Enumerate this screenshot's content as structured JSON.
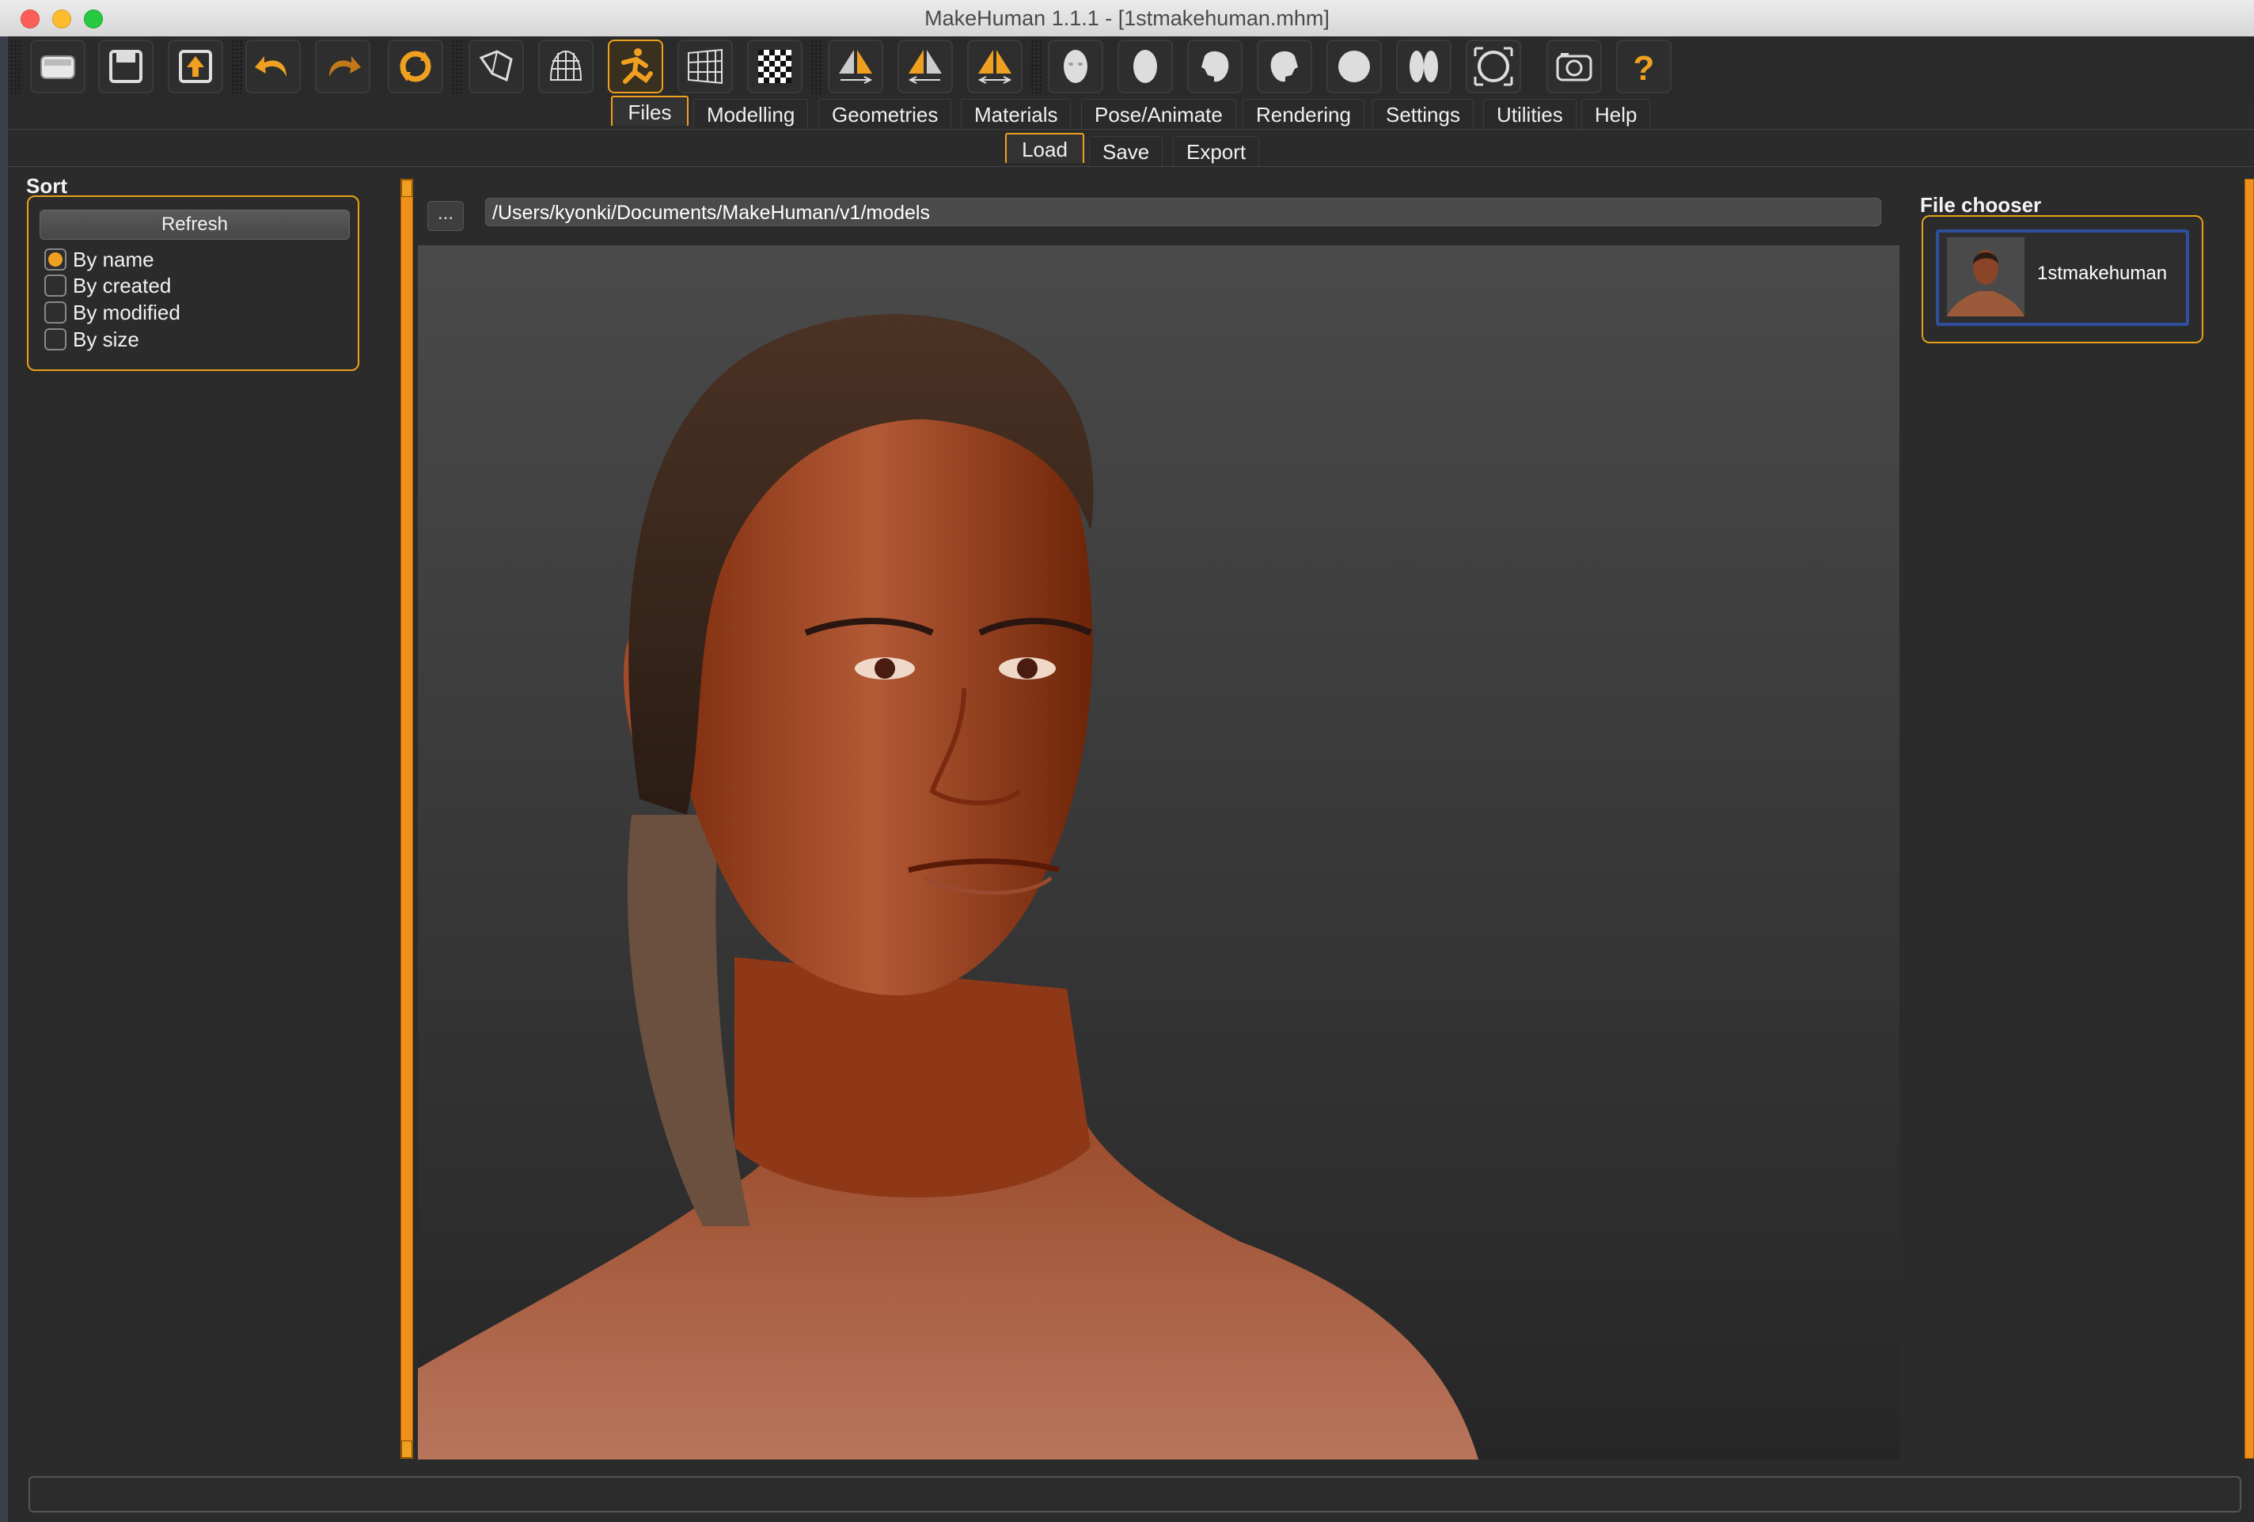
{
  "window": {
    "title": "MakeHuman 1.1.1 - [1stmakehuman.mhm]"
  },
  "toolbar": {
    "buttons": [
      {
        "icon": "open-icon"
      },
      {
        "icon": "save-icon"
      },
      {
        "icon": "export-icon"
      },
      {
        "icon": "undo-icon"
      },
      {
        "icon": "redo-icon"
      },
      {
        "icon": "reset-icon"
      },
      {
        "icon": "smooth-icon"
      },
      {
        "icon": "wireframe-icon"
      },
      {
        "icon": "pose-icon",
        "active": true
      },
      {
        "icon": "grid-icon"
      },
      {
        "icon": "checker-icon"
      },
      {
        "icon": "symmetry-right-icon"
      },
      {
        "icon": "symmetry-left-icon"
      },
      {
        "icon": "symmetry-both-icon"
      },
      {
        "icon": "front-view-icon"
      },
      {
        "icon": "back-view-icon"
      },
      {
        "icon": "left-view-icon"
      },
      {
        "icon": "right-view-icon"
      },
      {
        "icon": "top-view-icon"
      },
      {
        "icon": "bottom-view-icon"
      },
      {
        "icon": "reset-camera-icon"
      },
      {
        "icon": "screenshot-icon"
      },
      {
        "icon": "help-icon"
      }
    ]
  },
  "tabs": {
    "main": [
      "Files",
      "Modelling",
      "Geometries",
      "Materials",
      "Pose/Animate",
      "Rendering",
      "Settings",
      "Utilities",
      "Help"
    ],
    "active_main": "Files",
    "sub": [
      "Load",
      "Save",
      "Export"
    ],
    "active_sub": "Load"
  },
  "sort": {
    "title": "Sort",
    "refresh_label": "Refresh",
    "options": [
      "By name",
      "By created",
      "By modified",
      "By size"
    ],
    "selected": "By name"
  },
  "path": {
    "browse_label": "...",
    "value": "/Users/kyonki/Documents/MakeHuman/v1/models"
  },
  "file_chooser": {
    "title": "File chooser",
    "items": [
      {
        "name": "1stmakehuman",
        "selected": true
      }
    ]
  },
  "colors": {
    "accent": "#f0a020",
    "selection": "#2e4e9e",
    "background": "#2b2b2b"
  }
}
